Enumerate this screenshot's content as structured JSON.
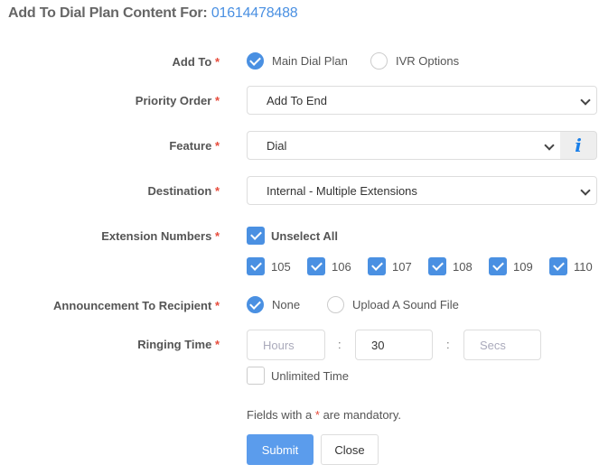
{
  "header": {
    "title_prefix": "Add To Dial Plan Content For:",
    "number": "01614478488"
  },
  "required_marker": "*",
  "add_to": {
    "label": "Add To",
    "options": [
      {
        "label": "Main Dial Plan",
        "selected": true
      },
      {
        "label": "IVR Options",
        "selected": false
      }
    ]
  },
  "priority_order": {
    "label": "Priority Order",
    "value": "Add To End"
  },
  "feature": {
    "label": "Feature",
    "value": "Dial",
    "info_icon": "i"
  },
  "destination": {
    "label": "Destination",
    "value": "Internal - Multiple Extensions"
  },
  "extension_numbers": {
    "label": "Extension Numbers",
    "toggle_all": {
      "label": "Unselect All",
      "checked": true
    },
    "extensions": [
      {
        "label": "105",
        "checked": true
      },
      {
        "label": "106",
        "checked": true
      },
      {
        "label": "107",
        "checked": true
      },
      {
        "label": "108",
        "checked": true
      },
      {
        "label": "109",
        "checked": true
      },
      {
        "label": "110",
        "checked": true
      }
    ]
  },
  "announcement": {
    "label": "Announcement To Recipient",
    "options": [
      {
        "label": "None",
        "selected": true
      },
      {
        "label": "Upload A Sound File",
        "selected": false
      }
    ]
  },
  "ringing_time": {
    "label": "Ringing Time",
    "hours": {
      "value": "",
      "placeholder": "Hours"
    },
    "mins": {
      "value": "30",
      "placeholder": ""
    },
    "secs": {
      "value": "",
      "placeholder": "Secs"
    },
    "separator": ":",
    "unlimited": {
      "label": "Unlimited Time",
      "checked": false
    }
  },
  "footer": {
    "note_before": "Fields with a",
    "note_after": "are mandatory.",
    "submit_label": "Submit",
    "close_label": "Close"
  }
}
